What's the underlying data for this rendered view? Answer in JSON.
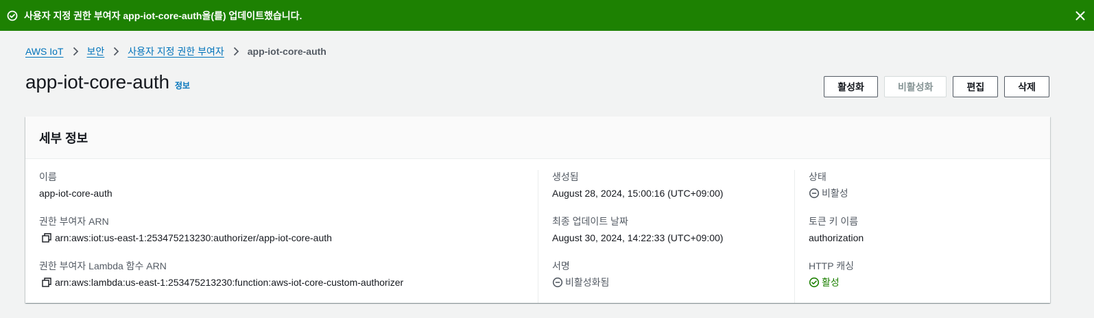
{
  "flash": {
    "message": "사용자 지정 권한 부여자 app-iot-core-auth을(를) 업데이트했습니다.",
    "icon": "check-circle-icon",
    "close_icon": "close-icon"
  },
  "breadcrumb": {
    "items": [
      "AWS IoT",
      "보안",
      "사용자 지정 권한 부여자"
    ],
    "current": "app-iot-core-auth"
  },
  "header": {
    "title": "app-iot-core-auth",
    "info": "정보"
  },
  "actions": {
    "activate": "활성화",
    "deactivate": "비활성화",
    "edit": "편집",
    "delete": "삭제"
  },
  "details": {
    "title": "세부 정보",
    "name_label": "이름",
    "name_value": "app-iot-core-auth",
    "authorizer_arn_label": "권한 부여자 ARN",
    "authorizer_arn_value": "arn:aws:iot:us-east-1:253475213230:authorizer/app-iot-core-auth",
    "lambda_arn_label": "권한 부여자 Lambda 함수 ARN",
    "lambda_arn_value": "arn:aws:lambda:us-east-1:253475213230:function:aws-iot-core-custom-authorizer",
    "created_label": "생성됨",
    "created_value": "August 28, 2024, 15:00:16 (UTC+09:00)",
    "updated_label": "최종 업데이트 날짜",
    "updated_value": "August 30, 2024, 14:22:33 (UTC+09:00)",
    "signing_label": "서명",
    "signing_value": "비활성화됨",
    "status_label": "상태",
    "status_value": "비활성",
    "token_key_label": "토큰 키 이름",
    "token_key_value": "authorization",
    "http_cache_label": "HTTP 캐싱",
    "http_cache_value": "활성"
  },
  "colors": {
    "success": "#1d8102",
    "link": "#0073bb",
    "muted": "#545b64"
  }
}
